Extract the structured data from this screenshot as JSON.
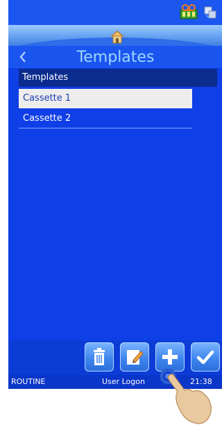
{
  "header": {
    "title": "Templates"
  },
  "list": {
    "header": "Templates",
    "items": [
      {
        "label": "Cassette 1",
        "selected": true
      },
      {
        "label": "Cassette 2",
        "selected": false
      }
    ]
  },
  "toolbar": {
    "buttons": [
      {
        "icon": "trash-icon"
      },
      {
        "icon": "edit-icon"
      },
      {
        "icon": "add-icon"
      },
      {
        "icon": "confirm-icon"
      }
    ]
  },
  "status": {
    "mode": "ROUTINE",
    "user": "User Logon",
    "time": "21:38"
  },
  "colors": {
    "background": "#0f3fe6",
    "title": "#9fd7ff",
    "list_header": "#0a2c8f",
    "selected_row": "#ededed"
  }
}
